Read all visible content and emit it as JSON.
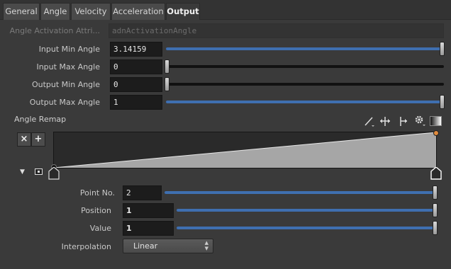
{
  "tabs": [
    {
      "label": "General",
      "active": false
    },
    {
      "label": "Angle",
      "active": false
    },
    {
      "label": "Velocity",
      "active": false
    },
    {
      "label": "Acceleration",
      "active": false
    },
    {
      "label": "Output",
      "active": true
    }
  ],
  "params": {
    "activation_attr": {
      "label": "Angle Activation Attri...",
      "value": "adnActivationAngle"
    },
    "input_min": {
      "label": "Input Min Angle",
      "value": "3.14159",
      "slider": 1.0
    },
    "input_max": {
      "label": "Input Max Angle",
      "value": "0",
      "slider": 0.0
    },
    "output_min": {
      "label": "Output Min Angle",
      "value": "0",
      "slider": 0.0
    },
    "output_max": {
      "label": "Output Max Angle",
      "value": "1",
      "slider": 1.0
    }
  },
  "ramp": {
    "label": "Angle Remap",
    "remove_label": "×",
    "add_label": "+",
    "point_no": {
      "label": "Point No.",
      "value": "2",
      "slider": 1.0
    },
    "position": {
      "label": "Position",
      "value": "1",
      "slider": 1.0
    },
    "value": {
      "label": "Value",
      "value": "1",
      "slider": 1.0
    },
    "interpolation": {
      "label": "Interpolation",
      "value": "Linear"
    }
  },
  "colors": {
    "accent": "#3f6fb0",
    "ramp_fill": "#a6a6a6",
    "point_selected": "#e08a3c"
  }
}
